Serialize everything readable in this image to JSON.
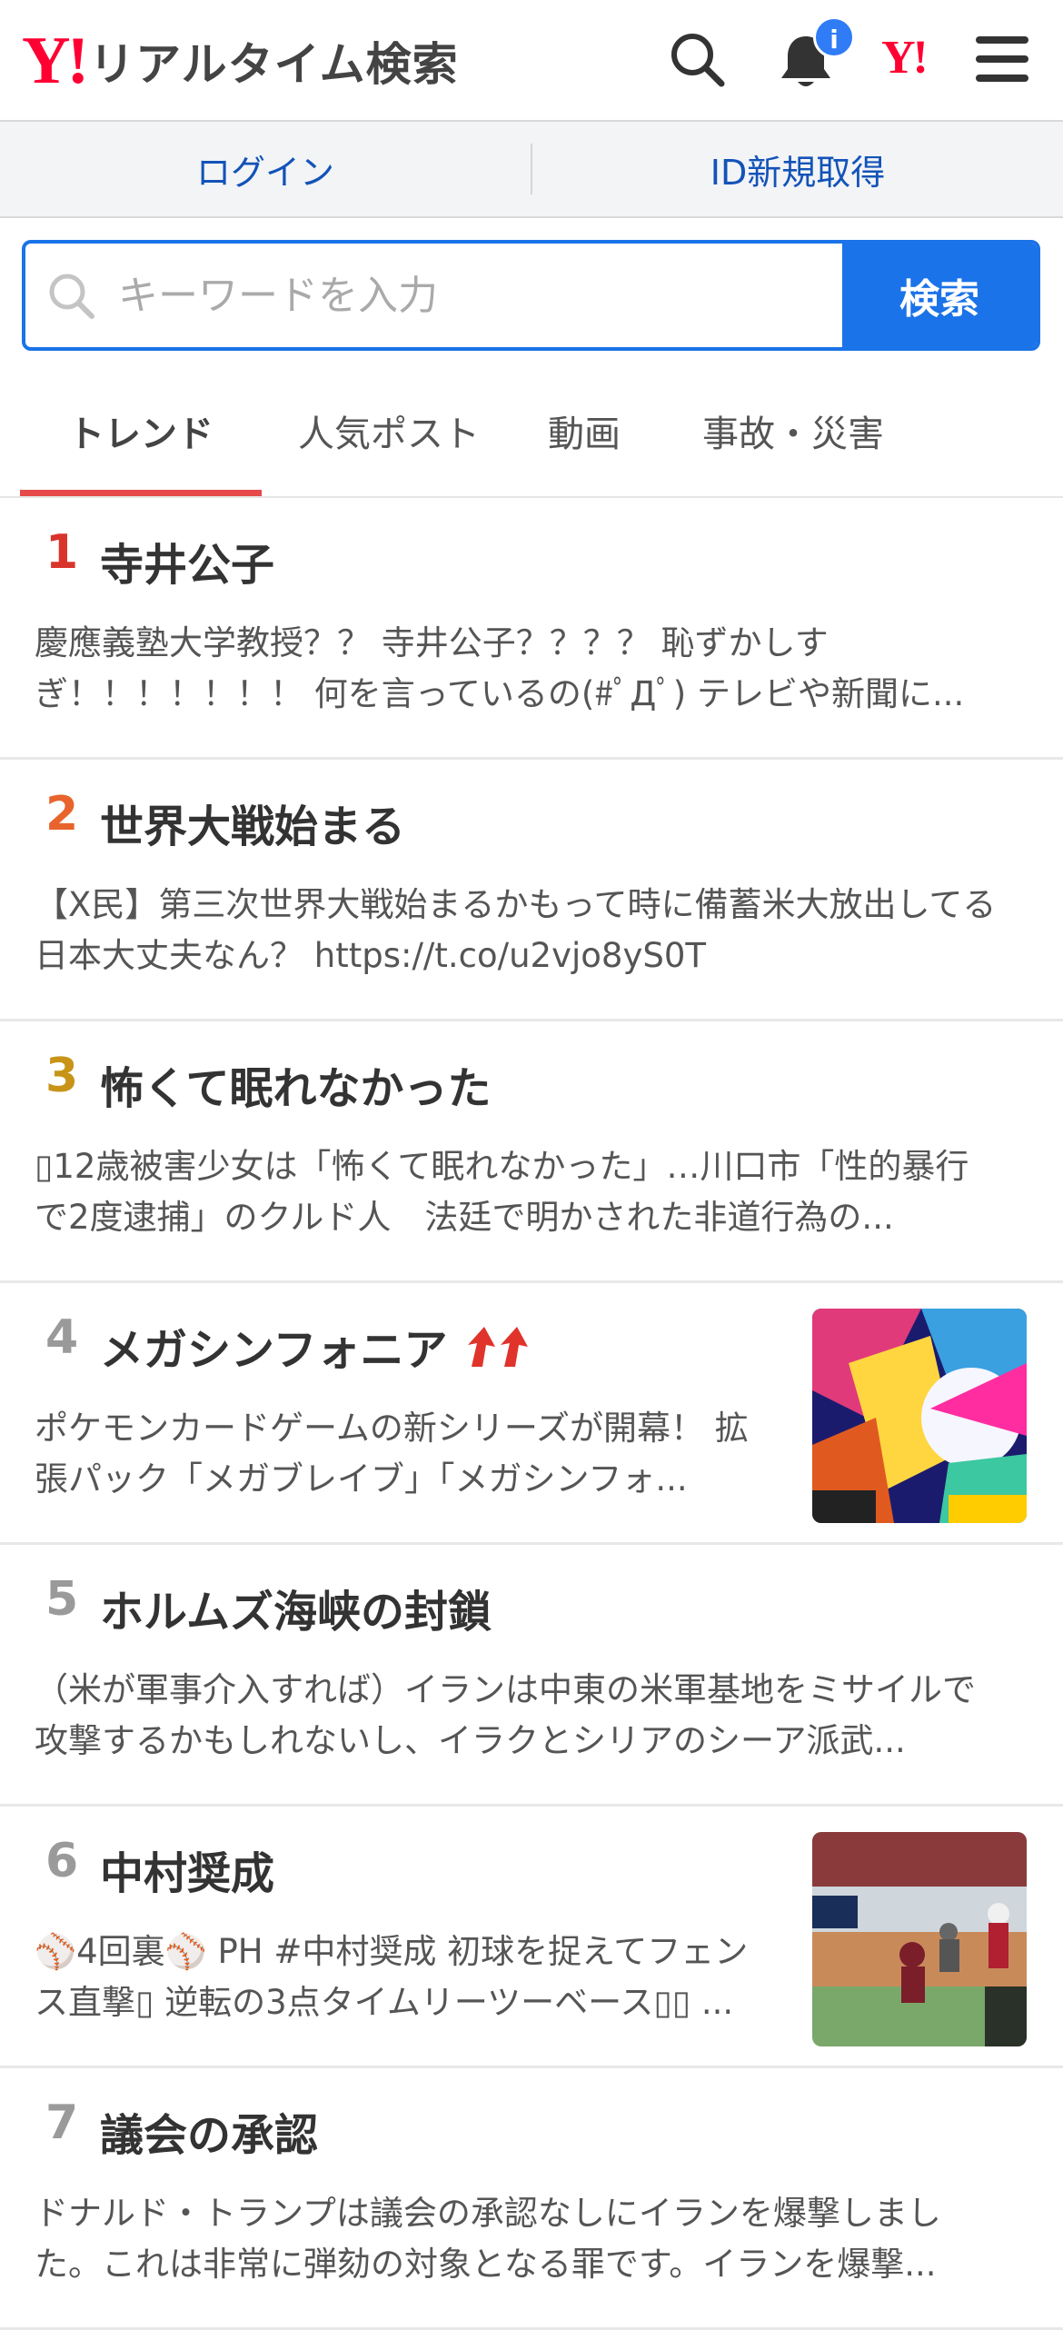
{
  "header": {
    "logo_y": "Y!",
    "logo_text": "リアルタイム検索",
    "notification_badge": "i",
    "yahoo_small": "Y!"
  },
  "login_bar": {
    "login": "ログイン",
    "register": "ID新規取得"
  },
  "search": {
    "placeholder": "キーワードを入力",
    "button": "検索"
  },
  "tabs": [
    {
      "label": "トレンド",
      "active": true
    },
    {
      "label": "人気ポスト",
      "active": false
    },
    {
      "label": "動画",
      "active": false
    },
    {
      "label": "事故・災害",
      "active": false
    }
  ],
  "trends": [
    {
      "rank": "1",
      "title": "寺井公子",
      "rank_color": "#d9342b",
      "desc": "慶應義塾大学教授？？ 寺井公子？？？？ 恥ずかしすぎ！！！！！！！ 何を言っているの(#ﾟДﾟ) テレビや新聞に..."
    },
    {
      "rank": "2",
      "title": "世界大戦始まる",
      "rank_color": "#e8642c",
      "desc": "【X民】第三次世界大戦始まるかもって時に備蓄米大放出してる日本大丈夫なん？ https://t.co/u2vjo8yS0T"
    },
    {
      "rank": "3",
      "title": "怖くて眠れなかった",
      "rank_color": "#c89418",
      "desc": "▯12歳被害少女は「怖くて眠れなかった」…川口市「性的暴行で2度逮捕」のクルド人　法廷で明かされた非道行為の..."
    },
    {
      "rank": "4",
      "title": "メガシンフォニア",
      "rank_color": "#9a9a9a",
      "trending_up": true,
      "desc": "ポケモンカードゲームの新シリーズが開幕！ 拡張パック「メガブレイブ」「メガシンフォ..."
    },
    {
      "rank": "5",
      "title": "ホルムズ海峡の封鎖",
      "rank_color": "#9a9a9a",
      "desc": "（米が軍事介入すれば）イランは中東の米軍基地をミサイルで攻撃するかもしれないし、イラクとシリアのシーア派武..."
    },
    {
      "rank": "6",
      "title": "中村奨成",
      "rank_color": "#9a9a9a",
      "desc": "⚾4回裏⚾ PH #中村奨成 初球を捉えてフェンス直撃▯ 逆転の3点タイムリーツーベース▯▯ ..."
    },
    {
      "rank": "7",
      "title": "議会の承認",
      "rank_color": "#9a9a9a",
      "desc": "ドナルド・トランプは議会の承認なしにイランを爆撃しました。これは非常に弾劾の対象となる罪です。イランを爆撃..."
    }
  ],
  "colors": {
    "accent_blue": "#1a73e8",
    "link_blue": "#1353b8",
    "tab_indicator": "#e64a4a",
    "yahoo_red": "#ff0033"
  }
}
